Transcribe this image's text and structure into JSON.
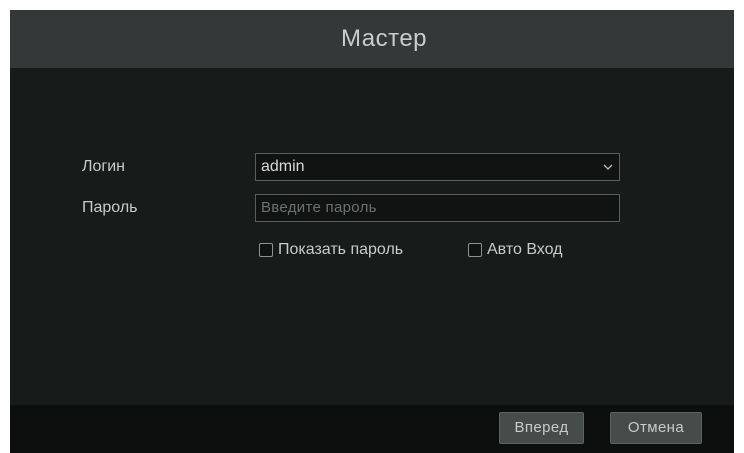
{
  "dialog": {
    "title": "Мастер"
  },
  "form": {
    "login_label": "Логин",
    "login_value": "admin",
    "password_label": "Пароль",
    "password_placeholder": "Введите пароль",
    "show_password_label": "Показать пароль",
    "auto_login_label": "Авто Вход"
  },
  "footer": {
    "next_label": "Вперед",
    "cancel_label": "Отмена"
  },
  "icons": {
    "login_dropdown": "chevron-down-icon",
    "show_password_checkbox": "checkbox-unchecked-icon",
    "auto_login_checkbox": "checkbox-unchecked-icon"
  },
  "colors": {
    "titlebar": "#343838",
    "body": "#171b1a",
    "footer": "#0d0f0e",
    "text": "#c8cbca",
    "button": "#474b4a"
  }
}
